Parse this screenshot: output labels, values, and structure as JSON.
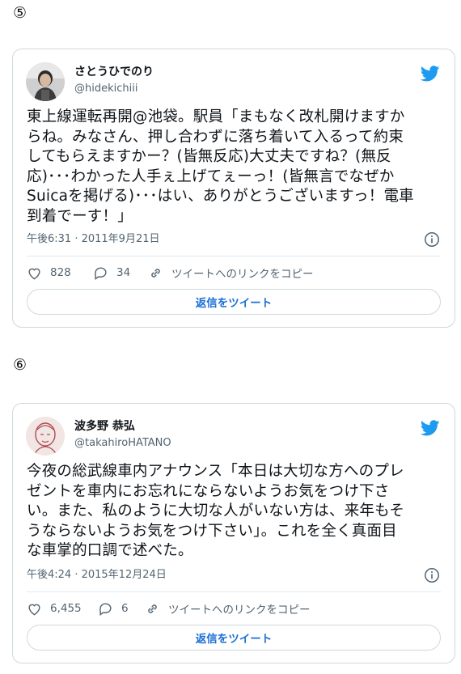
{
  "tweets": [
    {
      "marker": "⑤",
      "name": "さとうひでのり",
      "handle": "@hidekichiii",
      "text": "東上線運転再開@池袋。駅員「まもなく改札開けますか\nらね。みなさん、押し合わずに落ち着いて入るって約束\nしてもらえますかー？(皆無反応)大丈夫ですね？(無反\n応)･･･わかった人手ぇ上げてぇーっ！(皆無言でなぜか\nSuicaを掲げる)･･･はい、ありがとうございますっ！電車\n到着でーす！」",
      "timestamp": "午後6:31 · 2011年9月21日",
      "likes": "828",
      "replies": "34",
      "copy_link": "ツイートへのリンクをコピー",
      "reply_button": "返信をツイート",
      "avatar_icon": "person-avatar-icon"
    },
    {
      "marker": "⑥",
      "name": "波多野 恭弘",
      "handle": "@takahiroHATANO",
      "text": "今夜の総武線車内アナウンス「本日は大切な方へのプレ\nゼントを車内にお忘れにならないようお気をつけ下さ\nい。また、私のように大切な人がいない方は、来年もそ\nうならないようお気をつけ下さい」。これを全く真面目\nな車掌的口調で述べた。",
      "timestamp": "午後4:24 · 2015年12月24日",
      "likes": "6,455",
      "replies": "6",
      "copy_link": "ツイートへのリンクをコピー",
      "reply_button": "返信をツイート",
      "avatar_icon": "sketch-avatar-icon"
    }
  ],
  "colors": {
    "accent": "#1d9bf0",
    "border": "#cfd9de",
    "muted": "#536471"
  }
}
